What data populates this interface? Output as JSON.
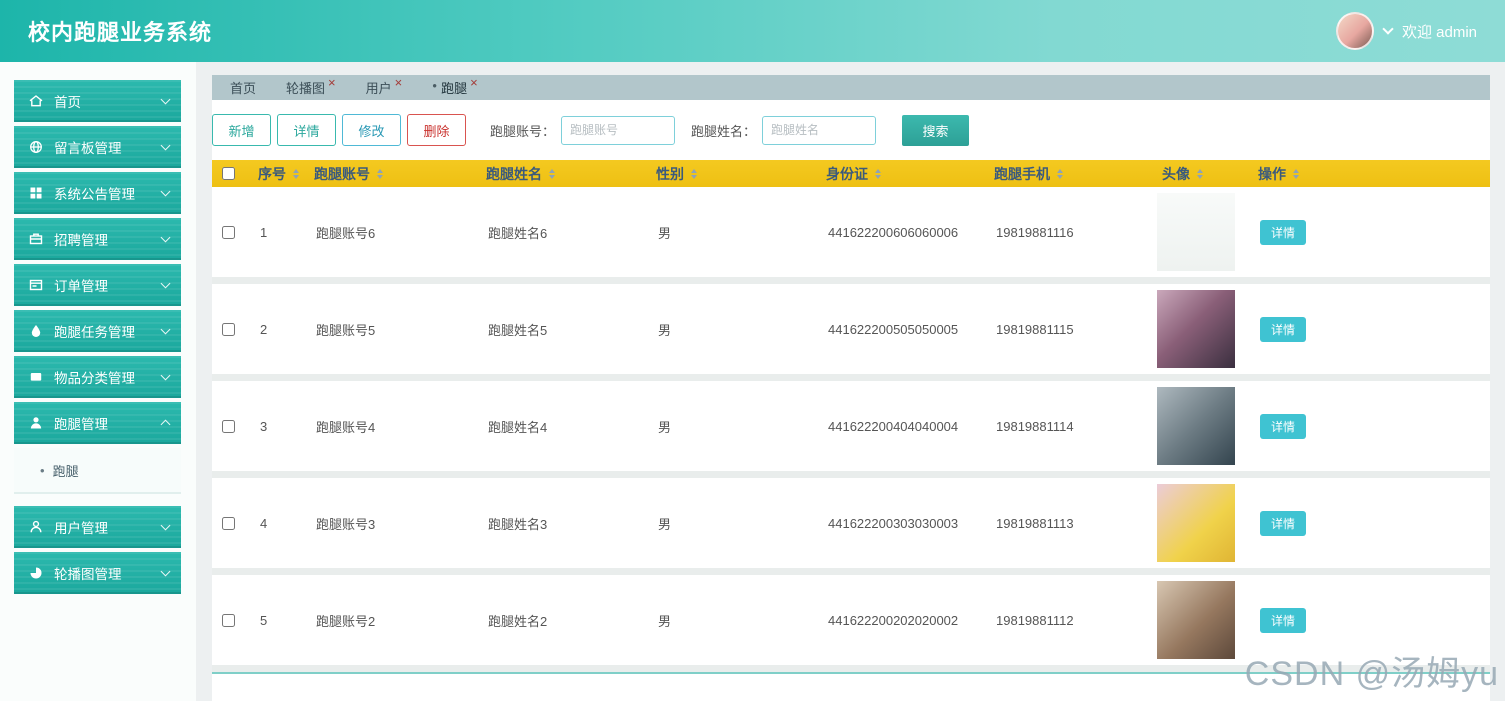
{
  "header": {
    "title": "校内跑腿业务系统",
    "welcome": "欢迎 admin"
  },
  "icons": {
    "close": "×",
    "active_dot": "●",
    "bullet": "•"
  },
  "sidebar": {
    "items": [
      {
        "label": "首页",
        "icon": "home-icon"
      },
      {
        "label": "留言板管理",
        "icon": "message-board-icon"
      },
      {
        "label": "系统公告管理",
        "icon": "announcement-icon"
      },
      {
        "label": "招聘管理",
        "icon": "recruit-icon"
      },
      {
        "label": "订单管理",
        "icon": "order-icon"
      },
      {
        "label": "跑腿任务管理",
        "icon": "task-icon"
      },
      {
        "label": "物品分类管理",
        "icon": "category-icon"
      },
      {
        "label": "跑腿管理",
        "icon": "runner-icon",
        "expanded": true
      },
      {
        "label": "用户管理",
        "icon": "user-icon"
      },
      {
        "label": "轮播图管理",
        "icon": "carousel-icon"
      }
    ],
    "submenu": {
      "label": "跑腿"
    }
  },
  "tabs": [
    {
      "label": "首页",
      "closable": false,
      "active": false
    },
    {
      "label": "轮播图",
      "closable": true,
      "active": false
    },
    {
      "label": "用户",
      "closable": true,
      "active": false
    },
    {
      "label": "跑腿",
      "closable": true,
      "active": true
    }
  ],
  "toolbar": {
    "add": "新增",
    "detail": "详情",
    "edit": "修改",
    "delete": "删除",
    "account_label": "跑腿账号：",
    "account_placeholder": "跑腿账号",
    "name_label": "跑腿姓名：",
    "name_placeholder": "跑腿姓名",
    "search": "搜索"
  },
  "table": {
    "headers": [
      "序号",
      "跑腿账号",
      "跑腿姓名",
      "性别",
      "身份证",
      "跑腿手机",
      "头像",
      "操作"
    ],
    "action_label": "详情",
    "rows": [
      {
        "seq": "1",
        "account": "跑腿账号6",
        "name": "跑腿姓名6",
        "gender": "男",
        "id_card": "441622200606060006",
        "phone": "19819881116",
        "avatar_css": "background:linear-gradient(180deg,#f8faf9,#eef2f0)"
      },
      {
        "seq": "2",
        "account": "跑腿账号5",
        "name": "跑腿姓名5",
        "gender": "男",
        "id_card": "441622200505050005",
        "phone": "19819881115",
        "avatar_css": "background:linear-gradient(135deg,#caa8bb 0%,#8a5f78 45%,#3a2f3f 100%)"
      },
      {
        "seq": "3",
        "account": "跑腿账号4",
        "name": "跑腿姓名4",
        "gender": "男",
        "id_card": "441622200404040004",
        "phone": "19819881114",
        "avatar_css": "background:linear-gradient(135deg,#aeb9bf 0%,#6d7c84 50%,#33444e 100%)"
      },
      {
        "seq": "4",
        "account": "跑腿账号3",
        "name": "跑腿姓名3",
        "gender": "男",
        "id_card": "441622200303030003",
        "phone": "19819881113",
        "avatar_css": "background:linear-gradient(135deg,#ecccd8 0%,#f0d24a 60%,#e0b534 100%)"
      },
      {
        "seq": "5",
        "account": "跑腿账号2",
        "name": "跑腿姓名2",
        "gender": "男",
        "id_card": "441622200202020002",
        "phone": "19819881112",
        "avatar_css": "background:linear-gradient(135deg,#d8c7b2 0%,#96785f 55%,#5d493b 100%)"
      }
    ]
  },
  "watermark": "CSDN @汤姆yu",
  "colors": {
    "accent_teal": "#2ab3a8",
    "header_gradient_start": "#1db5aa",
    "header_gradient_end": "#8edcd6",
    "table_header_gold": "#f2c41b",
    "table_header_text": "#3b5a7c",
    "delete_red": "#d9534f",
    "detail_button": "#3fc3d2",
    "tabbar_bg": "#b2c6cb"
  }
}
